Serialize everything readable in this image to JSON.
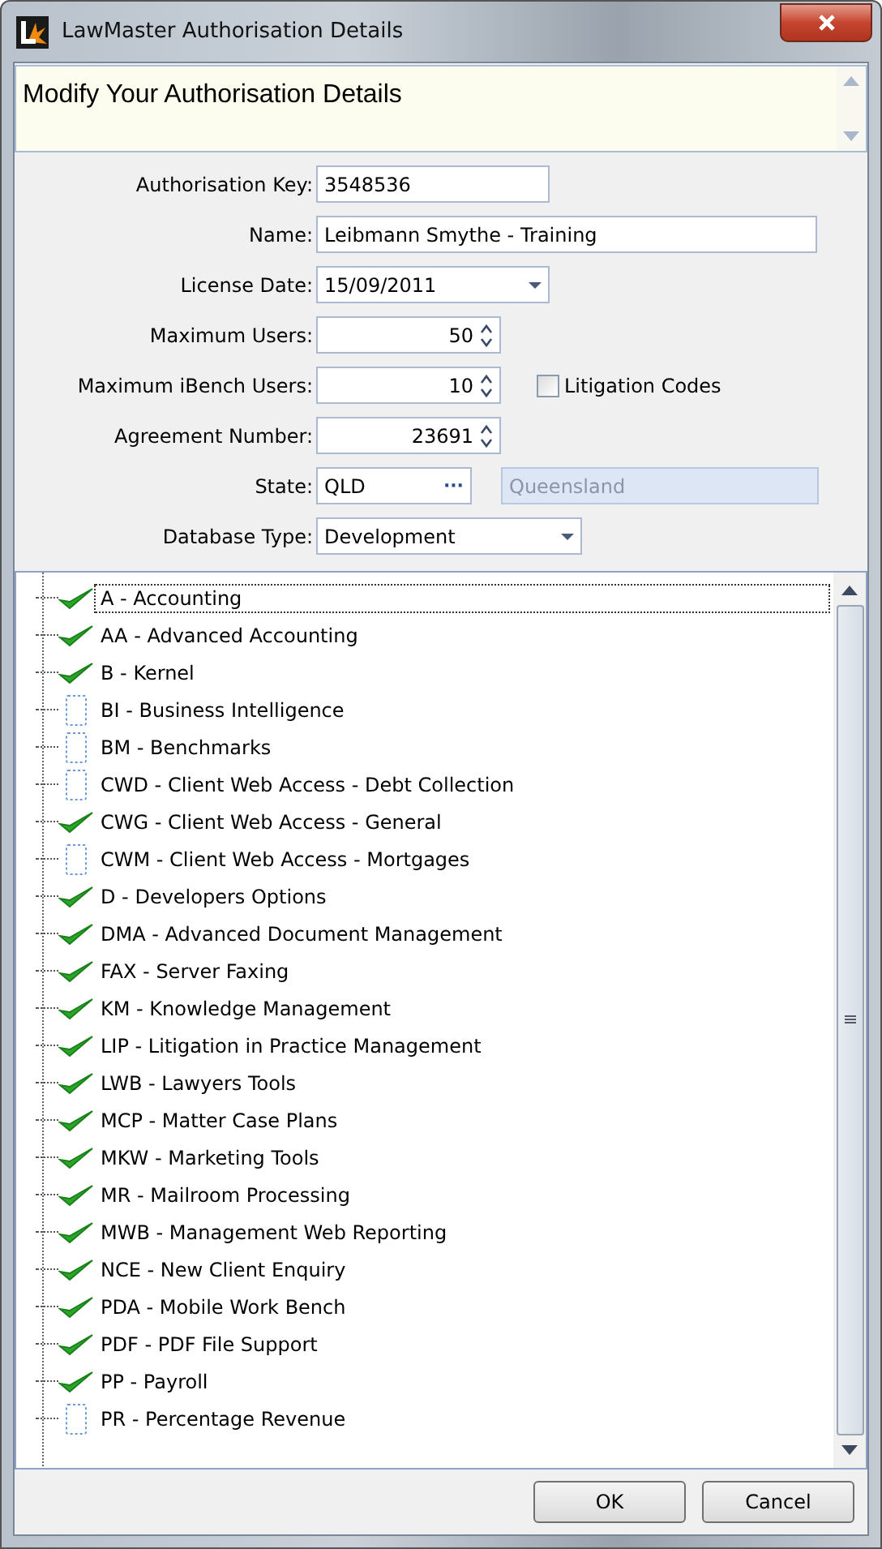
{
  "window": {
    "title": "LawMaster Authorisation Details"
  },
  "header": {
    "text": "Modify Your Authorisation Details"
  },
  "form": {
    "fields": [
      {
        "kind": "text",
        "label": "Authorisation Key:",
        "value": "3548536"
      },
      {
        "kind": "text",
        "label": "Name:",
        "value": "Leibmann Smythe - Training"
      },
      {
        "kind": "date",
        "label": "License Date:",
        "value": "15/09/2011"
      },
      {
        "kind": "spin",
        "label": "Maximum Users:",
        "value": "50"
      },
      {
        "kind": "spin",
        "label": "Maximum iBench Users:",
        "value": "10",
        "checkbox": {
          "label": "Litigation Codes",
          "checked": false
        }
      },
      {
        "kind": "spin",
        "label": "Agreement Number:",
        "value": "23691"
      },
      {
        "kind": "lookup",
        "label": "State:",
        "value": "QLD",
        "button": "···",
        "description": "Queensland"
      },
      {
        "kind": "dropdown",
        "label": "Database Type:",
        "value": "Development"
      }
    ]
  },
  "modules": [
    {
      "label": "A - Accounting",
      "checked": true,
      "selected": true
    },
    {
      "label": "AA - Advanced Accounting",
      "checked": true,
      "selected": false
    },
    {
      "label": "B - Kernel",
      "checked": true,
      "selected": false
    },
    {
      "label": "BI - Business Intelligence",
      "checked": false,
      "selected": false
    },
    {
      "label": "BM - Benchmarks",
      "checked": false,
      "selected": false
    },
    {
      "label": "CWD - Client Web Access - Debt Collection",
      "checked": false,
      "selected": false
    },
    {
      "label": "CWG - Client Web Access - General",
      "checked": true,
      "selected": false
    },
    {
      "label": "CWM - Client Web Access - Mortgages",
      "checked": false,
      "selected": false
    },
    {
      "label": "D - Developers Options",
      "checked": true,
      "selected": false
    },
    {
      "label": "DMA - Advanced Document Management",
      "checked": true,
      "selected": false
    },
    {
      "label": "FAX - Server Faxing",
      "checked": true,
      "selected": false
    },
    {
      "label": "KM - Knowledge Management",
      "checked": true,
      "selected": false
    },
    {
      "label": "LIP - Litigation in Practice Management",
      "checked": true,
      "selected": false
    },
    {
      "label": "LWB - Lawyers Tools",
      "checked": true,
      "selected": false
    },
    {
      "label": "MCP - Matter Case Plans",
      "checked": true,
      "selected": false
    },
    {
      "label": "MKW - Marketing Tools",
      "checked": true,
      "selected": false
    },
    {
      "label": "MR - Mailroom Processing",
      "checked": true,
      "selected": false
    },
    {
      "label": "MWB - Management Web Reporting",
      "checked": true,
      "selected": false
    },
    {
      "label": "NCE - New Client Enquiry",
      "checked": true,
      "selected": false
    },
    {
      "label": "PDA - Mobile Work Bench",
      "checked": true,
      "selected": false
    },
    {
      "label": "PDF - PDF File Support",
      "checked": true,
      "selected": false
    },
    {
      "label": "PP - Payroll",
      "checked": true,
      "selected": false
    },
    {
      "label": "PR - Percentage Revenue",
      "checked": false,
      "selected": false
    }
  ],
  "buttons": [
    "OK",
    "Cancel"
  ]
}
